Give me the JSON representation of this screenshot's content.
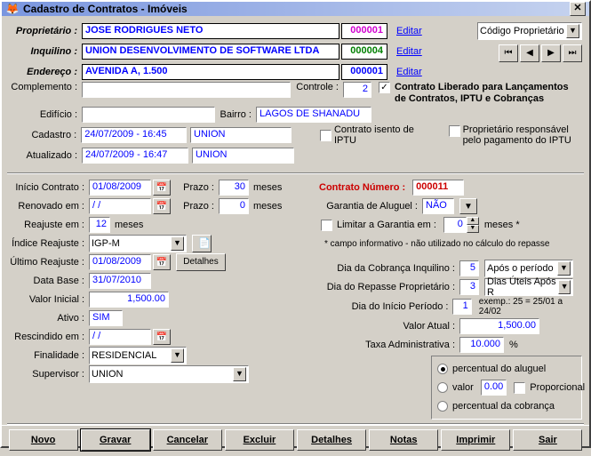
{
  "window": {
    "title": "Cadastro de Contratos - Imóveis"
  },
  "top": {
    "proprietario_label": "Proprietário :",
    "proprietario": "JOSE RODRIGUES NETO",
    "proprietario_code": "000001",
    "inquilino_label": "Inquilino :",
    "inquilino": "UNION DESENVOLVIMENTO DE SOFTWARE LTDA",
    "inquilino_code": "000004",
    "endereco_label": "Endereço :",
    "endereco": "AVENIDA A, 1.500",
    "endereco_code": "000001",
    "editar": "Editar",
    "codigo_combo": "Código Proprietário",
    "complemento_label": "Complemento :",
    "complemento": "",
    "controle_label": "Controle :",
    "controle": "2",
    "liberado": "Contrato Liberado para Lançamentos de Contratos, IPTU e Cobranças",
    "edificio_label": "Edifício :",
    "edificio": "",
    "bairro_label": "Bairro :",
    "bairro": "LAGOS DE SHANADU",
    "cadastro_label": "Cadastro :",
    "cadastro_dt": "24/07/2009 - 16:45",
    "cadastro_user": "UNION",
    "atualizado_label": "Atualizado :",
    "atualizado_dt": "24/07/2009 - 16:47",
    "atualizado_user": "UNION",
    "chk_isento": "Contrato isento de IPTU",
    "chk_prop_resp": "Proprietário responsável pelo pagamento do IPTU"
  },
  "left": {
    "inicio_label": "Início Contrato :",
    "inicio": "01/08/2009",
    "prazo_label": "Prazo :",
    "prazo": "30",
    "meses": "meses",
    "renovado_label": "Renovado em :",
    "renovado": "  /  /",
    "prazo2_label": "Prazo :",
    "prazo2": "0",
    "reajuste_label": "Reajuste em :",
    "reajuste": "12",
    "indice_label": "Índice Reajuste :",
    "indice": "IGP-M",
    "ultimo_label": "Último Reajuste :",
    "ultimo": "01/08/2009",
    "detalhes_btn": "Detalhes",
    "database_label": "Data Base :",
    "database": "31/07/2010",
    "valor_inicial_label": "Valor Inicial :",
    "valor_inicial": "1,500.00",
    "ativo_label": "Ativo :",
    "ativo": "SIM",
    "rescindido_label": "Rescindido em :",
    "rescindido": "  /  /",
    "finalidade_label": "Finalidade :",
    "finalidade": "RESIDENCIAL",
    "supervisor_label": "Supervisor :",
    "supervisor": "UNION"
  },
  "right": {
    "contrato_num_label": "Contrato Número :",
    "contrato_num": "000011",
    "garantia_label": "Garantia de Aluguel :",
    "garantia": "NÃO",
    "limitar_chk": "Limitar a Garantia em :",
    "limitar_val": "0",
    "meses_star": "meses *",
    "info_note": "* campo informativo - não utilizado no cálculo do repasse",
    "dia_cobranca_label": "Dia da Cobrança Inquilino :",
    "dia_cobranca": "5",
    "dia_cobranca_opt": "Após o período",
    "dia_repasse_label": "Dia do Repasse Proprietário :",
    "dia_repasse": "3",
    "dia_repasse_opt": "Dias Úteis Após R",
    "dia_inicio_label": "Dia do Início Período :",
    "dia_inicio": "1",
    "dia_inicio_hint": "exemp.: 25 = 25/01 a 24/02",
    "valor_atual_label": "Valor Atual :",
    "valor_atual": "1,500.00",
    "taxa_label": "Taxa Administrativa :",
    "taxa": "10.000",
    "taxa_pct": "%",
    "radio1": "percentual do aluguel",
    "radio2": "valor",
    "radio2_val": "0.00",
    "radio2_chk": "Proporcional",
    "radio3": "percentual da cobrança"
  },
  "buttons": {
    "novo": "Novo",
    "gravar": "Gravar",
    "cancelar": "Cancelar",
    "excluir": "Excluir",
    "detalhes": "Detalhes",
    "notas": "Notas",
    "imprimir": "Imprimir",
    "sair": "Sair"
  }
}
